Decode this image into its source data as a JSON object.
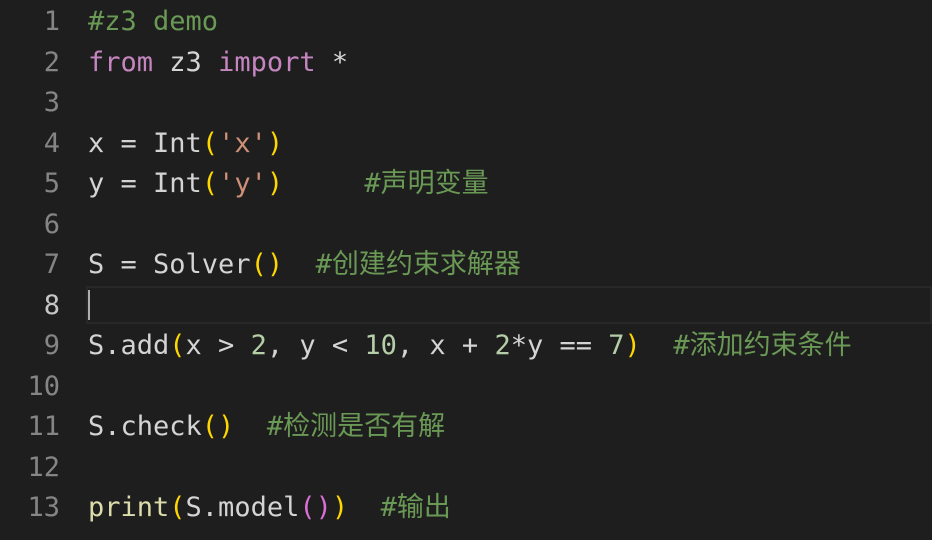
{
  "editor": {
    "active_line": 8,
    "colors": {
      "background": "#1e1e1e",
      "comment": "#6a9955",
      "keyword": "#c586c0",
      "function": "#dcdcaa",
      "string": "#ce9178",
      "number": "#b5cea8",
      "bracket_level1": "#ffd700",
      "bracket_level2": "#da70d6",
      "line_number": "#858585"
    },
    "lines": [
      {
        "number": "1",
        "tokens": [
          {
            "t": "#z3 demo",
            "k": "comment"
          }
        ]
      },
      {
        "number": "2",
        "tokens": [
          {
            "t": "from",
            "k": "keyword"
          },
          {
            "t": " z3 ",
            "k": "text"
          },
          {
            "t": "import",
            "k": "keyword"
          },
          {
            "t": " *",
            "k": "text"
          }
        ]
      },
      {
        "number": "3",
        "tokens": []
      },
      {
        "number": "4",
        "tokens": [
          {
            "t": "x = ",
            "k": "text"
          },
          {
            "t": "Int",
            "k": "text"
          },
          {
            "t": "(",
            "k": "brace1"
          },
          {
            "t": "'x'",
            "k": "string"
          },
          {
            "t": ")",
            "k": "brace1"
          }
        ]
      },
      {
        "number": "5",
        "tokens": [
          {
            "t": "y = ",
            "k": "text"
          },
          {
            "t": "Int",
            "k": "text"
          },
          {
            "t": "(",
            "k": "brace1"
          },
          {
            "t": "'y'",
            "k": "string"
          },
          {
            "t": ")",
            "k": "brace1"
          },
          {
            "t": "     ",
            "k": "text"
          },
          {
            "t": "#声明变量",
            "k": "comment"
          }
        ]
      },
      {
        "number": "6",
        "tokens": []
      },
      {
        "number": "7",
        "tokens": [
          {
            "t": "S = ",
            "k": "text"
          },
          {
            "t": "Solver",
            "k": "text"
          },
          {
            "t": "()",
            "k": "brace1"
          },
          {
            "t": "  ",
            "k": "text"
          },
          {
            "t": "#创建约束求解器",
            "k": "comment"
          }
        ]
      },
      {
        "number": "8",
        "tokens": []
      },
      {
        "number": "9",
        "tokens": [
          {
            "t": "S.add",
            "k": "text"
          },
          {
            "t": "(",
            "k": "brace1"
          },
          {
            "t": "x > ",
            "k": "text"
          },
          {
            "t": "2",
            "k": "number"
          },
          {
            "t": ", y < ",
            "k": "text"
          },
          {
            "t": "10",
            "k": "number"
          },
          {
            "t": ", x + ",
            "k": "text"
          },
          {
            "t": "2",
            "k": "number"
          },
          {
            "t": "*y == ",
            "k": "text"
          },
          {
            "t": "7",
            "k": "number"
          },
          {
            "t": ")",
            "k": "brace1"
          },
          {
            "t": "  ",
            "k": "text"
          },
          {
            "t": "#添加约束条件",
            "k": "comment"
          }
        ]
      },
      {
        "number": "10",
        "tokens": []
      },
      {
        "number": "11",
        "tokens": [
          {
            "t": "S.check",
            "k": "text"
          },
          {
            "t": "()",
            "k": "brace1"
          },
          {
            "t": "  ",
            "k": "text"
          },
          {
            "t": "#检测是否有解",
            "k": "comment"
          }
        ]
      },
      {
        "number": "12",
        "tokens": []
      },
      {
        "number": "13",
        "tokens": [
          {
            "t": "print",
            "k": "func"
          },
          {
            "t": "(",
            "k": "brace1"
          },
          {
            "t": "S.model",
            "k": "text"
          },
          {
            "t": "()",
            "k": "brace2"
          },
          {
            "t": ")",
            "k": "brace1"
          },
          {
            "t": "  ",
            "k": "text"
          },
          {
            "t": "#输出",
            "k": "comment"
          }
        ]
      }
    ]
  }
}
